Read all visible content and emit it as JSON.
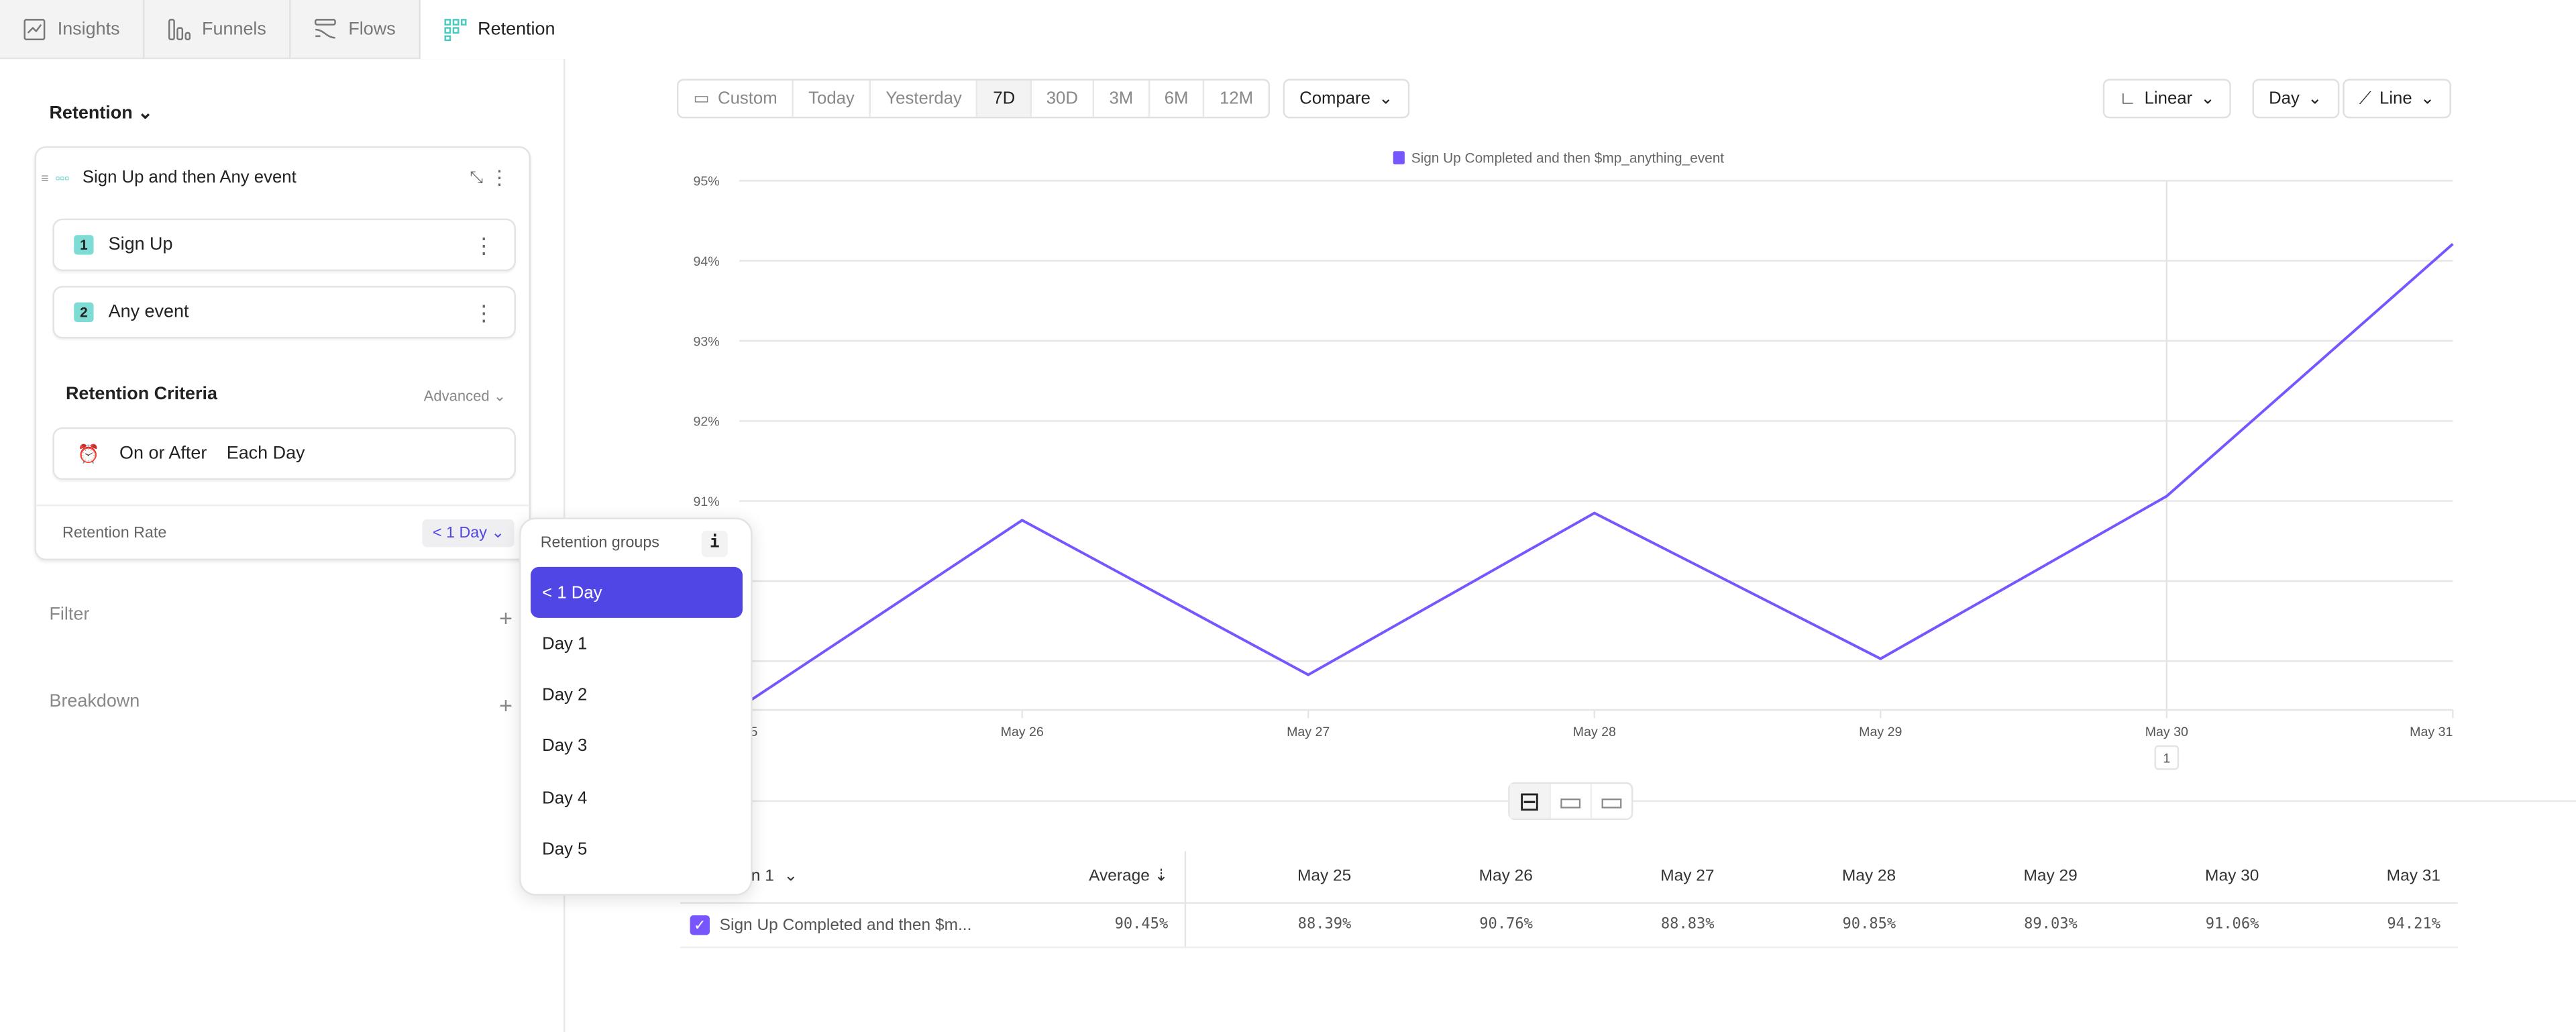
{
  "tabs": [
    {
      "label": "Insights",
      "icon": "line-chart-icon"
    },
    {
      "label": "Funnels",
      "icon": "funnel-bars-icon"
    },
    {
      "label": "Flows",
      "icon": "flows-icon"
    },
    {
      "label": "Retention",
      "icon": "retention-grid-icon",
      "active": true
    }
  ],
  "left": {
    "section_title": "Retention",
    "card": {
      "title": "Sign Up and then Any event",
      "steps": [
        {
          "num": "1",
          "label": "Sign Up"
        },
        {
          "num": "2",
          "label": "Any event"
        }
      ],
      "criteria_title": "Retention Criteria",
      "advanced_label": "Advanced",
      "criteria": {
        "mode": "On or After",
        "period": "Each Day"
      },
      "rate_label": "Retention Rate",
      "rate_value": "< 1 Day"
    },
    "filter_label": "Filter",
    "breakdown_label": "Breakdown"
  },
  "popup": {
    "title": "Retention groups",
    "info": "i",
    "options": [
      "< 1 Day",
      "Day 1",
      "Day 2",
      "Day 3",
      "Day 4",
      "Day 5"
    ],
    "selected": "< 1 Day"
  },
  "toolbar": {
    "date_ranges": [
      "Custom",
      "Today",
      "Yesterday",
      "7D",
      "30D",
      "3M",
      "6M",
      "12M"
    ],
    "active_range": "7D",
    "compare": "Compare",
    "scale": "Linear",
    "interval": "Day",
    "chart_type": "Line"
  },
  "colors": {
    "accent": "#4f46e5",
    "series": "#7856ff",
    "badge": "#7fdcd4"
  },
  "chart_data": {
    "type": "line",
    "x": [
      "May 25",
      "May 26",
      "May 27",
      "May 28",
      "May 29",
      "May 30",
      "May 31"
    ],
    "series": [
      {
        "name": "Sign Up Completed and then $mp_anything_event",
        "values": [
          88.39,
          90.76,
          88.83,
          90.85,
          89.03,
          91.06,
          94.21
        ]
      }
    ],
    "yticks": [
      "95%",
      "94%",
      "93%",
      "92%",
      "91%"
    ],
    "ytick_values": [
      95,
      94,
      93,
      92,
      91,
      90,
      89
    ],
    "ylim": [
      88.35,
      95
    ],
    "grid": true,
    "legend": "top-center",
    "hover_x": "May 30",
    "hover_marker": "1"
  },
  "table": {
    "col0": "Retention 1",
    "avg_header": "Average",
    "dates": [
      "May 25",
      "May 26",
      "May 27",
      "May 28",
      "May 29",
      "May 30",
      "May 31"
    ],
    "rows": [
      {
        "name": "Sign Up Completed and then $m...",
        "avg": "90.45%",
        "values": [
          "88.39%",
          "90.76%",
          "88.83%",
          "90.85%",
          "89.03%",
          "91.06%",
          "94.21%"
        ]
      }
    ]
  }
}
